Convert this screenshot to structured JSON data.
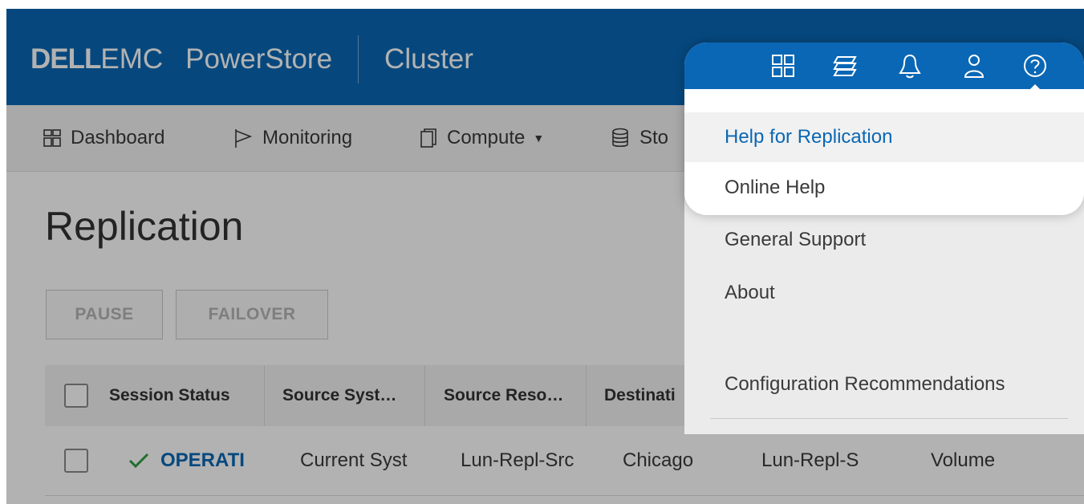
{
  "header": {
    "logo_dell": "DELL",
    "logo_emc": "EMC",
    "product": "PowerStore",
    "context": "Cluster",
    "icons": [
      "dashboard-icon",
      "jobs-icon",
      "bell-icon",
      "user-icon",
      "help-icon"
    ]
  },
  "nav": {
    "items": [
      {
        "label": "Dashboard",
        "icon": "dashboard-icon"
      },
      {
        "label": "Monitoring",
        "icon": "flag-icon"
      },
      {
        "label": "Compute",
        "icon": "compute-icon",
        "dropdown": true
      },
      {
        "label": "Sto",
        "icon": "storage-icon"
      }
    ]
  },
  "page": {
    "title": "Replication",
    "actions": [
      "PAUSE",
      "FAILOVER"
    ]
  },
  "table": {
    "columns": [
      "Session Status",
      "Source Syst…",
      "Source Reso…",
      "Destinati"
    ],
    "rows": [
      {
        "status": "OPERATI",
        "source_system": "Current Syst",
        "source_resource": "Lun-Repl-Src",
        "destination": "Chicago",
        "destination_resource": "Lun-Repl-S",
        "type": "Volume"
      }
    ]
  },
  "help_menu": {
    "items": [
      {
        "label": "Help for Replication",
        "highlighted": true
      },
      {
        "label": "Online Help"
      },
      {
        "label": "General Support"
      },
      {
        "label": "About"
      },
      {
        "label": "Configuration Recommendations"
      }
    ]
  },
  "colors": {
    "brand_blue": "#0a67b5",
    "nav_bg": "#f2f2f2",
    "ok_green": "#2f9e44",
    "link_blue": "#0a67b5"
  }
}
